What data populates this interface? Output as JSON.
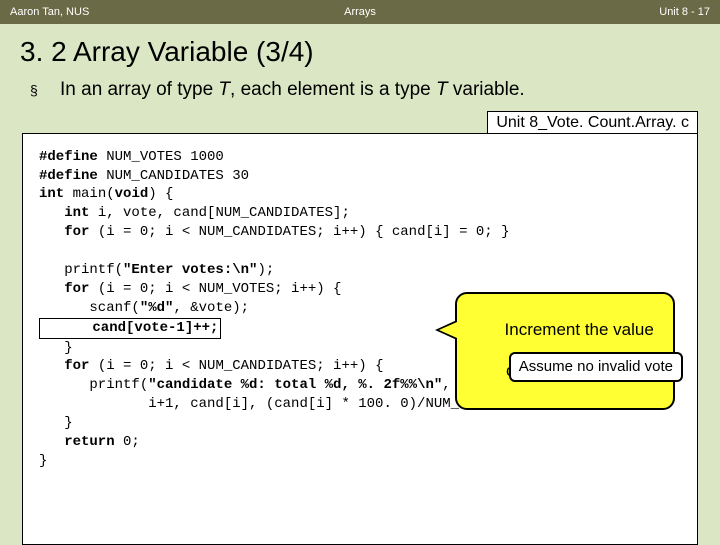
{
  "header": {
    "author": "Aaron Tan, NUS",
    "topic": "Arrays",
    "unit": "Unit 8 - 17"
  },
  "title": "3. 2 Array Variable (3/4)",
  "bullet": {
    "pre": "In an array of type ",
    "t1": "T",
    "mid": ", each element is a type ",
    "t2": "T",
    "post": " variable."
  },
  "file_label": "Unit 8_Vote. Count.Array. c",
  "code": {
    "l1a": "#define",
    "l1b": " NUM_VOTES 1000",
    "l2a": "#define",
    "l2b": " NUM_CANDIDATES 30",
    "l3a": "int",
    "l3b": " main(",
    "l3c": "void",
    "l3d": ") {",
    "l4a": "   int",
    "l4b": " i, vote, cand[NUM_CANDIDATES];",
    "l5a": "   for",
    "l5b": " (i = 0; i < NUM_CANDIDATES; i++) { cand[i] = 0; }",
    "blank1": "",
    "l6a": "   printf(",
    "l6b": "\"Enter votes:\\n\"",
    "l6c": ");",
    "l7a": "   for",
    "l7b": " (i = 0; i < NUM_VOTES; i++) {",
    "l8a": "      scanf(",
    "l8b": "\"%d\"",
    "l8c": ", &vote);",
    "l9": "      cand[vote-1]++;",
    "l10": "   }",
    "l11a": "   for",
    "l11b": " (i = 0; i < NUM_CANDIDATES; i++) {",
    "l12a": "      printf(",
    "l12b": "\"candidate %d: total %d, %. 2f%%\\n\"",
    "l12c": ",",
    "l13": "             i+1, cand[i], (cand[i] * 100. 0)/NUM_VOTES);",
    "l14": "   }",
    "l15a": "   return",
    "l15b": " 0;",
    "l16": "}"
  },
  "callouts": {
    "increment_line1": "Increment the value",
    "increment_line2": "of an array element",
    "assume": "Assume no invalid vote"
  }
}
